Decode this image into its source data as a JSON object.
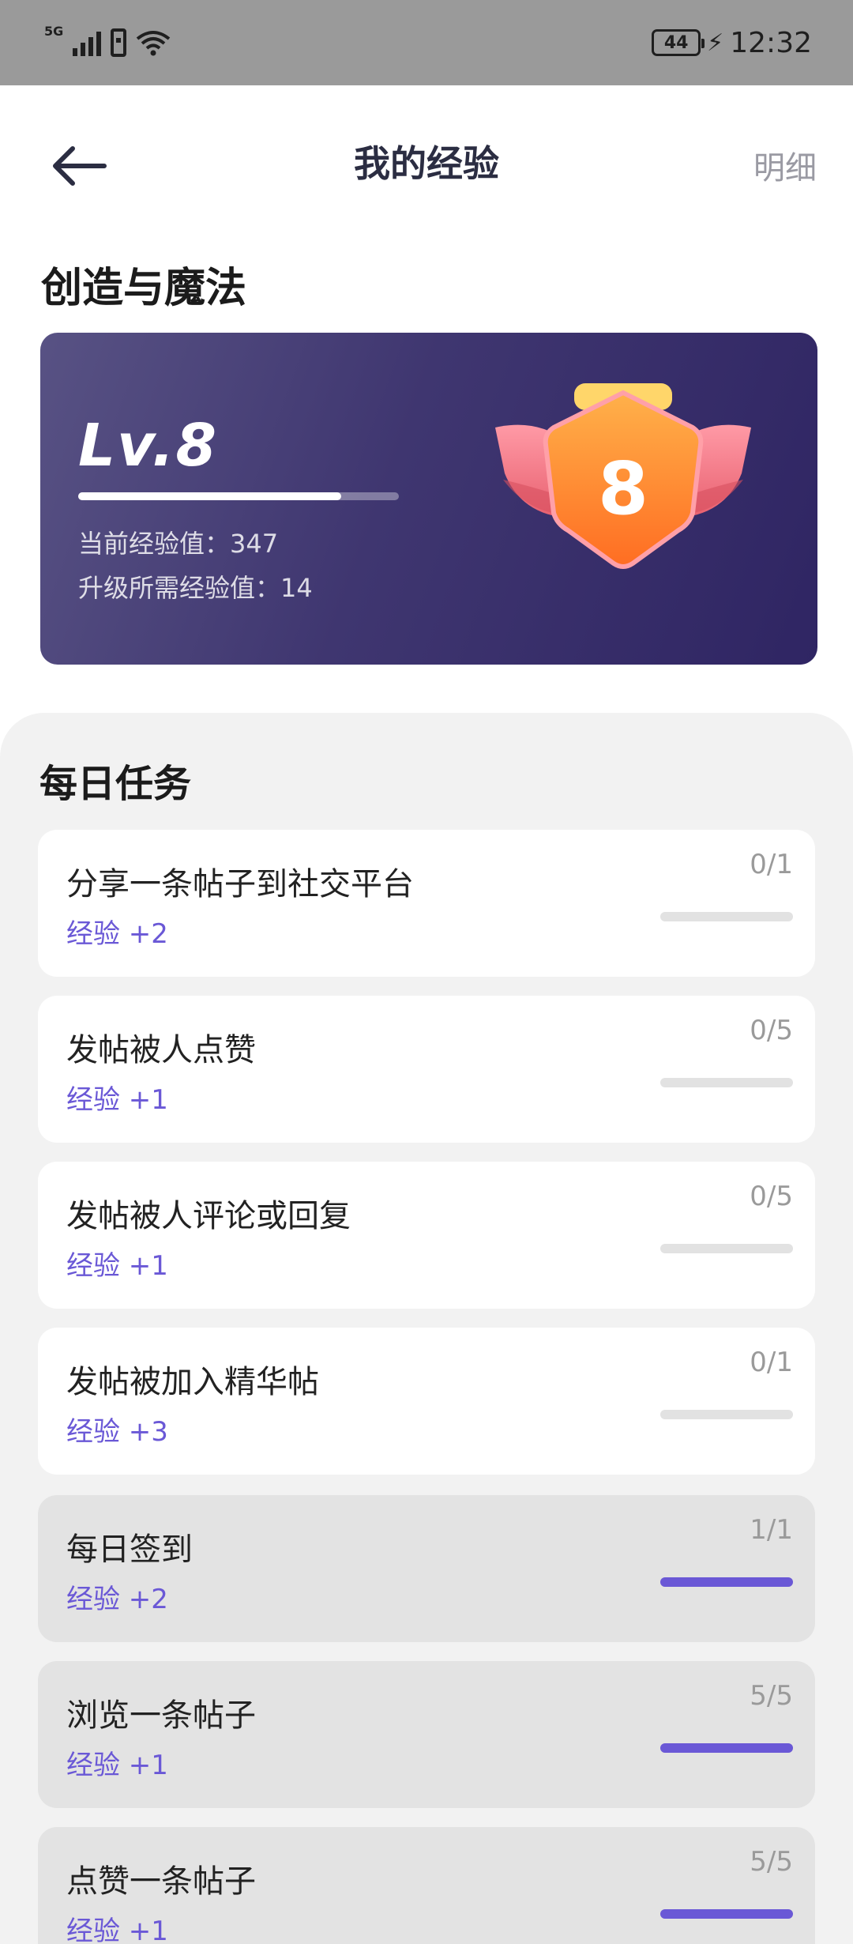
{
  "status_bar": {
    "network": "5G",
    "battery": "44",
    "time": "12:32"
  },
  "header": {
    "title": "我的经验",
    "detail_label": "明细"
  },
  "level_section": {
    "title": "创造与魔法",
    "level_label": "Lv.8",
    "badge_number": "8",
    "progress_fraction": 0.82,
    "current_exp": "当前经验值：347",
    "needed_exp": "升级所需经验值：14"
  },
  "daily_tasks": {
    "title": "每日任务",
    "items": [
      {
        "name": "分享一条帖子到社交平台",
        "reward": "经验 +2",
        "count": "0/1",
        "progress": 0,
        "done": false
      },
      {
        "name": "发帖被人点赞",
        "reward": "经验 +1",
        "count": "0/5",
        "progress": 0,
        "done": false
      },
      {
        "name": "发帖被人评论或回复",
        "reward": "经验 +1",
        "count": "0/5",
        "progress": 0,
        "done": false
      },
      {
        "name": "发帖被加入精华帖",
        "reward": "经验 +3",
        "count": "0/1",
        "progress": 0,
        "done": false
      },
      {
        "name": "每日签到",
        "reward": "经验 +2",
        "count": "1/1",
        "progress": 1,
        "done": true
      },
      {
        "name": "浏览一条帖子",
        "reward": "经验 +1",
        "count": "5/5",
        "progress": 1,
        "done": true
      },
      {
        "name": "点赞一条帖子",
        "reward": "经验 +1",
        "count": "5/5",
        "progress": 1,
        "done": true
      }
    ]
  },
  "colors": {
    "accent": "#6a58d6",
    "card_gradient_start": "#585284",
    "card_gradient_end": "#2f2563",
    "badge_orange": "#ff8a2a",
    "badge_wing": "#f27a8a"
  }
}
